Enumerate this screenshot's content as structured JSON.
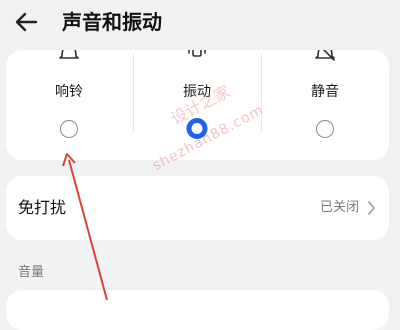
{
  "header": {
    "title": "声音和振动",
    "back_icon": "back-arrow-icon"
  },
  "ring_modes": {
    "items": [
      {
        "label": "响铃",
        "icon": "bell-icon",
        "selected": false
      },
      {
        "label": "振动",
        "icon": "vibrate-icon",
        "selected": true
      },
      {
        "label": "静音",
        "icon": "bell-off-icon",
        "selected": false
      }
    ],
    "accent_color": "#1f63e8"
  },
  "do_not_disturb": {
    "label": "免打扰",
    "status": "已关闭"
  },
  "volume": {
    "section_label": "音量"
  },
  "watermark": {
    "line1": "设计之家",
    "line2": "shezhan88.com"
  }
}
